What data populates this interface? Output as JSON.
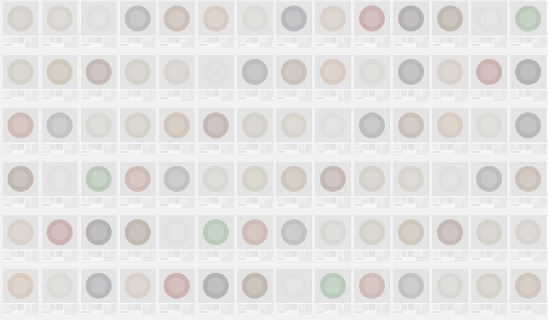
{
  "page": {
    "background": "#f2f2f2",
    "grid": {
      "columns": 14,
      "rows": 6
    }
  },
  "cards": [
    {
      "icon": "salad-bowl-photo",
      "color": "#a89a86"
    },
    {
      "icon": "rice-bowl-photo",
      "color": "#b3a892"
    },
    {
      "icon": "white-plate-photo",
      "color": "#c9c9c9"
    },
    {
      "icon": "bundt-cake-photo",
      "color": "#5c5c5c"
    },
    {
      "icon": "burger-photo",
      "color": "#8a6a4a"
    },
    {
      "icon": "flatbread-photo",
      "color": "#b88b6a"
    },
    {
      "icon": "drink-glass-photo",
      "color": "#c0bcb0"
    },
    {
      "icon": "waffle-iron-photo",
      "color": "#4a4f58"
    },
    {
      "icon": "sandwich-photo",
      "color": "#b59a85"
    },
    {
      "icon": "tomato-soup-photo",
      "color": "#8c3a2e"
    },
    {
      "icon": "jar-photo",
      "color": "#3f3a36"
    },
    {
      "icon": "curry-pan-photo",
      "color": "#6a4a30"
    },
    {
      "icon": "dessert-cup-photo",
      "color": "#d2cfc8"
    },
    {
      "icon": "cucumber-salad-photo",
      "color": "#4f8a4a"
    },
    {
      "icon": "pizza-photo",
      "color": "#9a5a44"
    },
    {
      "icon": "snowflake-cookie-photo",
      "color": "#6e6e6e"
    },
    {
      "icon": "pudding-photo",
      "color": "#b9b2a6"
    },
    {
      "icon": "grain-salad-photo",
      "color": "#a7a07e"
    },
    {
      "icon": "roll-photo",
      "color": "#9b7a56"
    },
    {
      "icon": "steak-photo",
      "color": "#7a4f42"
    }
  ],
  "labels": {
    "card_caption": ""
  }
}
